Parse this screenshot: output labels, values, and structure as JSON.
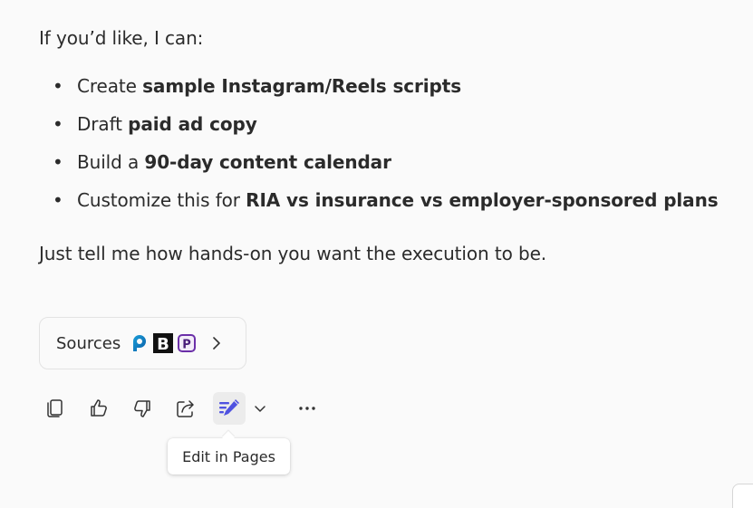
{
  "message": {
    "intro": "If you’d like, I can:",
    "bullets": [
      {
        "prefix": "Create ",
        "bold": "sample Instagram/Reels scripts"
      },
      {
        "prefix": "Draft ",
        "bold": "paid ad copy"
      },
      {
        "prefix": "Build a ",
        "bold": "90-day content calendar"
      },
      {
        "prefix": "Customize this for ",
        "bold": "RIA vs insurance vs employer-sponsored plans"
      }
    ],
    "outro": "Just tell me how hands-on you want the execution to be."
  },
  "sources": {
    "label": "Sources",
    "icons": [
      "p-logo-icon",
      "b-logo-icon",
      "p-purple-logo-icon"
    ],
    "icon_letters": [
      "B",
      "P"
    ]
  },
  "toolbar": {
    "buttons": [
      "copy-icon",
      "thumbs-up-icon",
      "thumbs-down-icon",
      "share-icon",
      "edit-in-pages-icon",
      "chevron-down-icon",
      "more-icon"
    ],
    "tooltip": "Edit in Pages"
  },
  "colors": {
    "accent": "#4f52e0",
    "text": "#2b2b2b",
    "background": "#fafafa"
  }
}
